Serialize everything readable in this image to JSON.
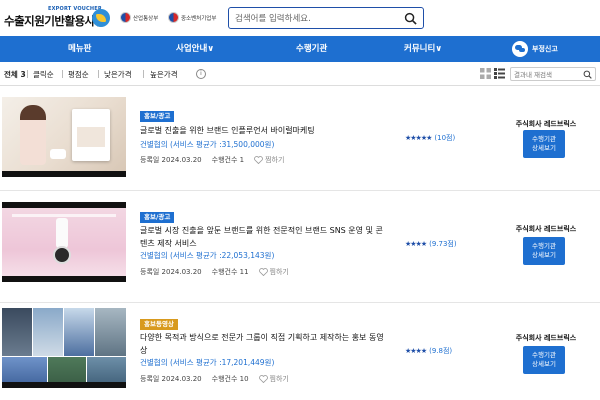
{
  "header": {
    "logo_sub": "EXPORT VOUCHER",
    "logo_main": "수출지원기반활용사업",
    "ministry_1": "산업통상부",
    "ministry_2": "중소벤처기업부",
    "search_placeholder": "검색어를 입력하세요."
  },
  "nav": {
    "items": [
      "메뉴판",
      "사업안내∨",
      "수행기관",
      "커뮤니티∨"
    ],
    "consult": "부정신고"
  },
  "filter": {
    "total_label": "전체",
    "total_count": "3",
    "sorts": [
      "클릭순",
      "평점순",
      "낮은가격",
      "높은가격"
    ],
    "inner_search_placeholder": "결과내 재검색"
  },
  "results": [
    {
      "tag": "홍보/광고",
      "title": "글로벌 진출을 위한 브랜드 인플루언서 바이럴마케팅",
      "company_line": "건별협의   (서비스 평균가 :31,500,000원)",
      "registered": "등록일 2024.03.20",
      "count": "수행건수 1",
      "like": "찜하기",
      "stars": "★★★★★",
      "score": "(10점)",
      "seller": "주식회사 레드브릭스",
      "detail_1": "수행기관",
      "detail_2": "상세보기"
    },
    {
      "tag": "홍보/광고",
      "title": "글로벌 시장 진출을 앞둔 브랜드를 위한 전문적인 브랜드 SNS 운영 및 콘텐츠 제작 서비스",
      "company_line": "건별협의   (서비스 평균가 :22,053,143원)",
      "registered": "등록일 2024.03.20",
      "count": "수행건수 11",
      "like": "찜하기",
      "stars": "★★★★",
      "score": "(9.73점)",
      "seller": "주식회사 레드브릭스",
      "detail_1": "수행기관",
      "detail_2": "상세보기"
    },
    {
      "tag": "홍보동영상",
      "title": "다양한 목적과 방식으로 전문가 그룹이 직접 기획하고 제작하는 홍보 동영상",
      "company_line": "건별협의   (서비스 평균가 :17,201,449원)",
      "registered": "등록일 2024.03.20",
      "count": "수행건수 10",
      "like": "찜하기",
      "stars": "★★★★",
      "score": "(9.8점)",
      "seller": "주식회사 레드브릭스",
      "detail_1": "수행기관",
      "detail_2": "상세보기"
    }
  ],
  "colors": {
    "brand_blue": "#1e6fd0",
    "tag_video": "#d89a1e"
  }
}
